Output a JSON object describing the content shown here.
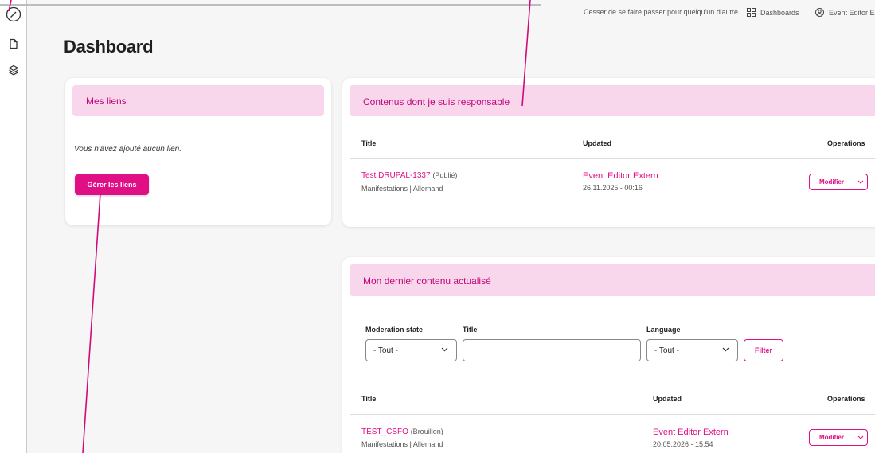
{
  "topbar": {
    "stop_impersonate": "Cesser de se faire passer pour quelqu'un d'autre",
    "dashboards": "Dashboards",
    "user": "Event Editor Extern"
  },
  "page": {
    "title": "Dashboard"
  },
  "links_card": {
    "title": "Mes liens",
    "empty_text": "Vous n'avez ajouté aucun lien.",
    "button": "Gérer les liens"
  },
  "responsible_card": {
    "title": "Contenus dont je suis responsable",
    "columns": [
      "Title",
      "Updated",
      "Operations"
    ],
    "rows": [
      {
        "title": "Test DRUPAL-1337",
        "state": "(Publié)",
        "meta": "Manifestations | Allemand",
        "author": "Event Editor Extern",
        "date": "26.11.2025 - 00:16",
        "operation": "Modifier"
      }
    ]
  },
  "recent_card": {
    "title": "Mon dernier contenu actualisé",
    "filters": {
      "moderation_label": "Moderation state",
      "moderation_value": "- Tout -",
      "title_label": "Title",
      "title_value": "",
      "language_label": "Language",
      "language_value": "- Tout -",
      "filter_button": "Filter"
    },
    "columns": [
      "Title",
      "Updated",
      "Operations"
    ],
    "rows": [
      {
        "title": "TEST_CSFO",
        "state": "(Brouillon)",
        "meta": "Manifestations | Allemand",
        "author": "Event Editor Extern",
        "date": "20.05.2026 - 15:54",
        "operation": "Modifier"
      }
    ]
  },
  "colors": {
    "accent": "#e10f86",
    "accent_dark": "#c2087a",
    "header_bg": "#f8d6ec"
  }
}
